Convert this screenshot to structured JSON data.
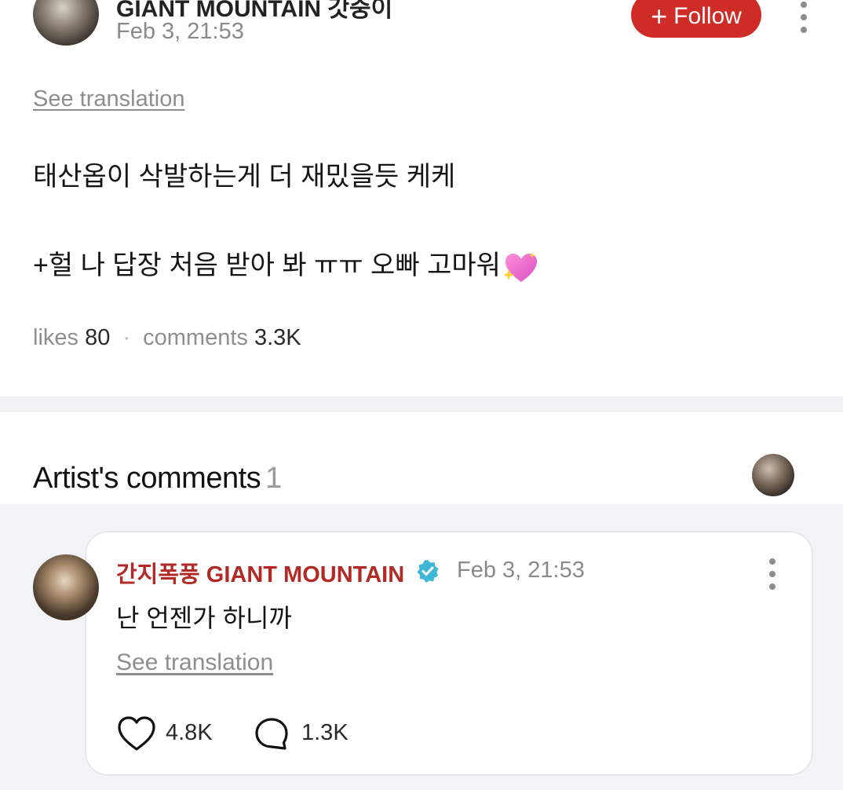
{
  "post": {
    "author": "GIANT MOUNTAIN 갓중이",
    "date": "Feb 3, 21:53",
    "follow_label": "Follow",
    "see_translation": "See translation",
    "body_line1": "태산옵이 삭발하는게 더 재밌을듯 케케",
    "body_line2": "+헐 나 답장 처음 받아 봐 ㅠㅠ 오빠 고마워",
    "stats": {
      "likes_label": "likes",
      "likes_value": "80",
      "comments_label": "comments",
      "comments_value": "3.3K"
    }
  },
  "artist_comments": {
    "title": "Artist's comments",
    "count": "1",
    "comment": {
      "author": "간지폭풍 GIANT MOUNTAIN",
      "date": "Feb 3, 21:53",
      "text": "난 언젠가 하니까",
      "see_translation": "See translation",
      "likes": "4.8K",
      "replies": "1.3K"
    }
  },
  "colors": {
    "accent": "#cf2b27",
    "artist_name": "#b22a26",
    "verified": "#3fb8d6",
    "muted_text": "#8e8e8e"
  },
  "icons": {
    "follow": "plus-icon",
    "menu": "kebab-menu-icon",
    "verified": "verified-badge-icon",
    "like": "heart-outline-icon",
    "reply": "speech-bubble-icon",
    "emoji": "sparkling-heart-emoji"
  }
}
